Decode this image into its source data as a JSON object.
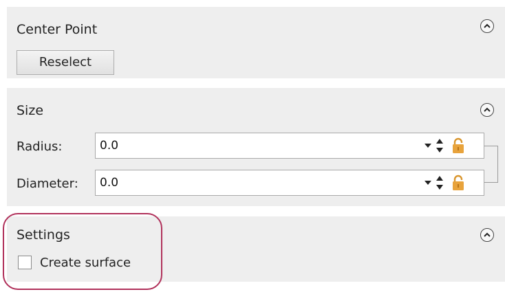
{
  "center_point": {
    "title": "Center Point",
    "reselect_label": "Reselect"
  },
  "size": {
    "title": "Size",
    "radius": {
      "label": "Radius:",
      "value": "0.0"
    },
    "diameter": {
      "label": "Diameter:",
      "value": "0.0"
    }
  },
  "settings": {
    "title": "Settings",
    "create_surface_label": "Create surface",
    "create_surface_checked": false
  },
  "icons": {
    "collapse": "chevron-up-icon",
    "dropdown": "dropdown-arrow-icon",
    "spinner": "spinner-arrows-icon",
    "lock": "padlock-icon"
  },
  "colors": {
    "panel_bg": "#eeeeee",
    "lock": "#e0a040",
    "highlight": "#b0305a"
  }
}
